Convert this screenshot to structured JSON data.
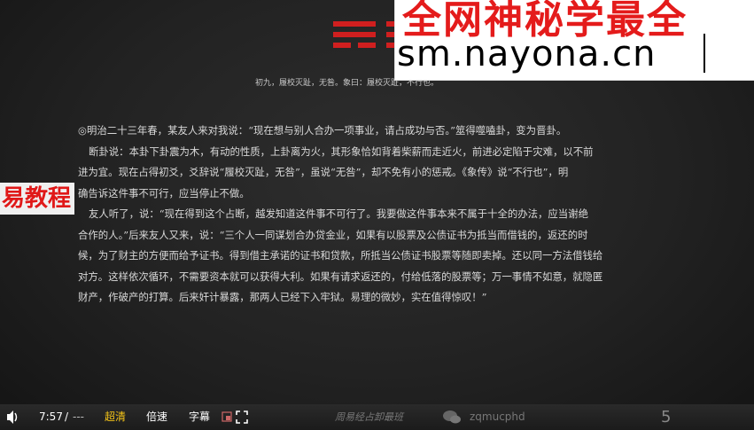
{
  "watermark": {
    "line1": "全网神秘学最全",
    "line2": "sm.nayona.cn"
  },
  "slide": {
    "top_line": "初九，履校灭趾，无咎。象曰：履校灭趾，不行也。",
    "paragraphs": [
      "◎明治二十三年春，某友人来对我说：“现在想与别人合办一项事业，请占成功与否。”筮得噬嗑卦，变为晋卦。",
      "断卦说：本卦下卦震为木，有动的性质，上卦离为火，其形象恰如背着柴薪而走近火，前进必定陷于灾难，以不前",
      "进为宜。现在占得初爻，爻辞说“履校灭趾，无咎”，虽说“无咎”，却不免有小的惩戒。《象传》说“不行也”，明",
      "确告诉这件事不可行，应当停止不做。",
      "友人听了，说：“现在得到这个占断，越发知道这件事不可行了。我要做这件事本来不属于十全的办法，应当谢绝",
      "合作的人。”后来友人又来，说：“三个人一同谋划合办贷金业，如果有以股票及公债证书为抵当而借钱的，返还的时",
      "候，为了财主的方便而给予证书。得到借主承诺的证书和贷款，所抵当公债证书股票等随即卖掉。还以同一方法借钱给",
      "对方。这样依次循环，不需要资本就可以获得大利。如果有请求返还的，付给低落的股票等；万一事情不如意，就隐匿",
      "财产，作破产的打算。后来奸计暴露，那两人已经下入牢狱。易理的微妙，实在值得惊叹！”"
    ],
    "badge": "易教程",
    "footer_brand": "周易经占卸最班",
    "wechat_id": "zqmucphd",
    "page_number": "5"
  },
  "player": {
    "current_time": "7:57",
    "separator": "/",
    "total_time": "---",
    "quality_label": "超清",
    "speed_label": "倍速",
    "subtitle_label": "字幕"
  },
  "colors": {
    "accent": "#f5c518",
    "trigram_red": "#d01f1f",
    "badge_red": "#e01818"
  },
  "icons": [
    "volume-icon",
    "pip-icon",
    "fullscreen-icon",
    "wechat-icon"
  ]
}
